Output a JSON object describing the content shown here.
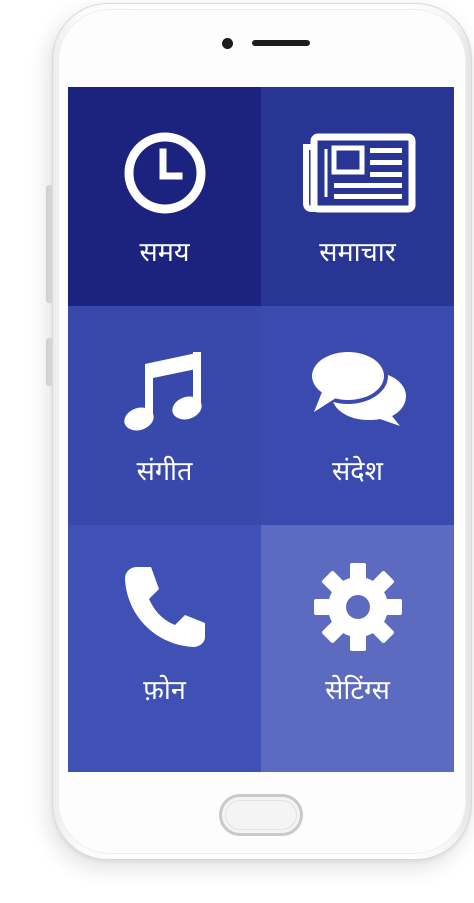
{
  "tiles": [
    {
      "label": "समय",
      "icon": "clock-icon",
      "color": "#1b237e"
    },
    {
      "label": "समाचार",
      "icon": "newspaper-icon",
      "color": "#283593"
    },
    {
      "label": "संगीत",
      "icon": "music-note-icon",
      "color": "#3949ab"
    },
    {
      "label": "संदेश",
      "icon": "chat-bubbles-icon",
      "color": "#3a4aae"
    },
    {
      "label": "फ़ोन",
      "icon": "phone-icon",
      "color": "#3f51b5"
    },
    {
      "label": "सेटिंग्स",
      "icon": "gear-icon",
      "color": "#5c6bc0"
    }
  ]
}
